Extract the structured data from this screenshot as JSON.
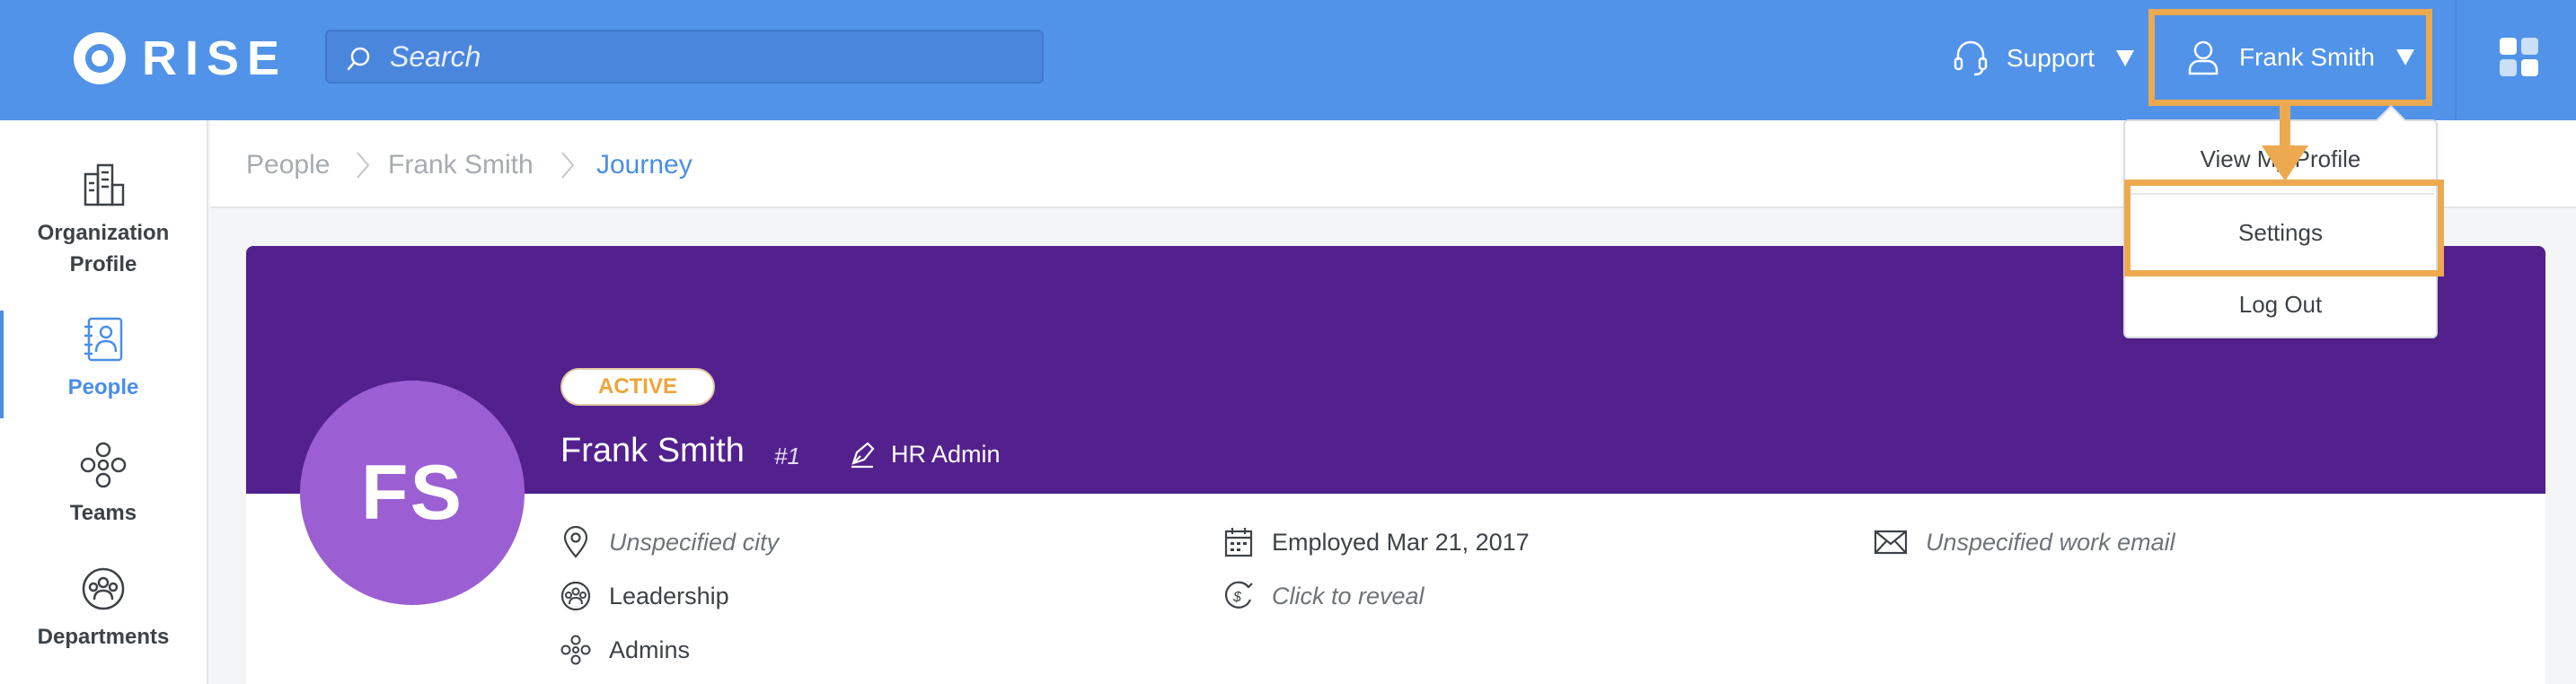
{
  "app": {
    "logo_text": "RISE"
  },
  "search": {
    "placeholder": "Search"
  },
  "header": {
    "support_label": "Support",
    "user_name": "Frank Smith"
  },
  "sidebar": {
    "items": [
      {
        "label_line1": "Organization",
        "label_line2": "Profile",
        "icon": "building-icon"
      },
      {
        "label": "People",
        "icon": "people-book-icon",
        "active": true
      },
      {
        "label": "Teams",
        "icon": "teams-icon"
      },
      {
        "label": "Departments",
        "icon": "departments-icon"
      }
    ]
  },
  "breadcrumb": [
    "People",
    "Frank Smith",
    "Journey"
  ],
  "profile": {
    "initials": "FS",
    "status": "ACTIVE",
    "name": "Frank Smith",
    "employee_number": "#1",
    "role": "HR Admin",
    "city": "Unspecified city",
    "employed": "Employed Mar 21, 2017",
    "work_email": "Unspecified work email",
    "department": "Leadership",
    "salary": "Click to reveal",
    "team": "Admins"
  },
  "user_dropdown": {
    "items": [
      "View My Profile",
      "Settings",
      "Log Out"
    ]
  },
  "colors": {
    "topbar": "#5193e8",
    "banner": "#53218d",
    "avatar": "#9b5fd3",
    "highlight": "#eda94f",
    "accent": "#4a8ee6",
    "status": "#f0a439"
  }
}
